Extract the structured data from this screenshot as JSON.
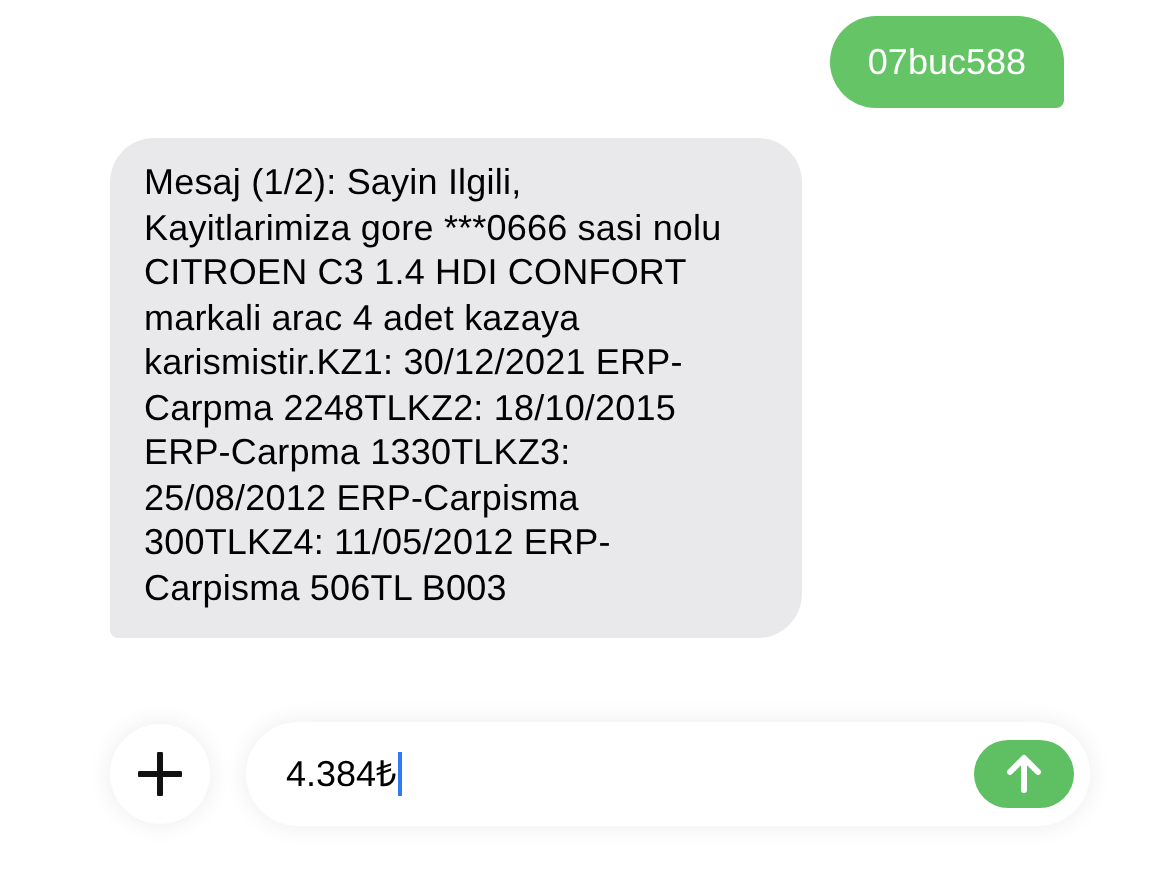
{
  "messages": [
    {
      "kind": "sent",
      "text": "07buc588"
    },
    {
      "kind": "received",
      "text": "Mesaj (1/2): Sayin Ilgili, Kayitlarimiza gore ***0666 sasi nolu CITROEN C3 1.4 HDI CONFORT markali arac 4 adet kazaya karismistir.KZ1: 30/12/2021 ERP-Carpma 2248TLKZ2: 18/10/2015 ERP-Carpma 1330TLKZ3: 25/08/2012 ERP-Carpisma 300TLKZ4: 11/05/2012 ERP-Carpisma 506TL B003"
    }
  ],
  "composer": {
    "value": "4.384₺"
  }
}
